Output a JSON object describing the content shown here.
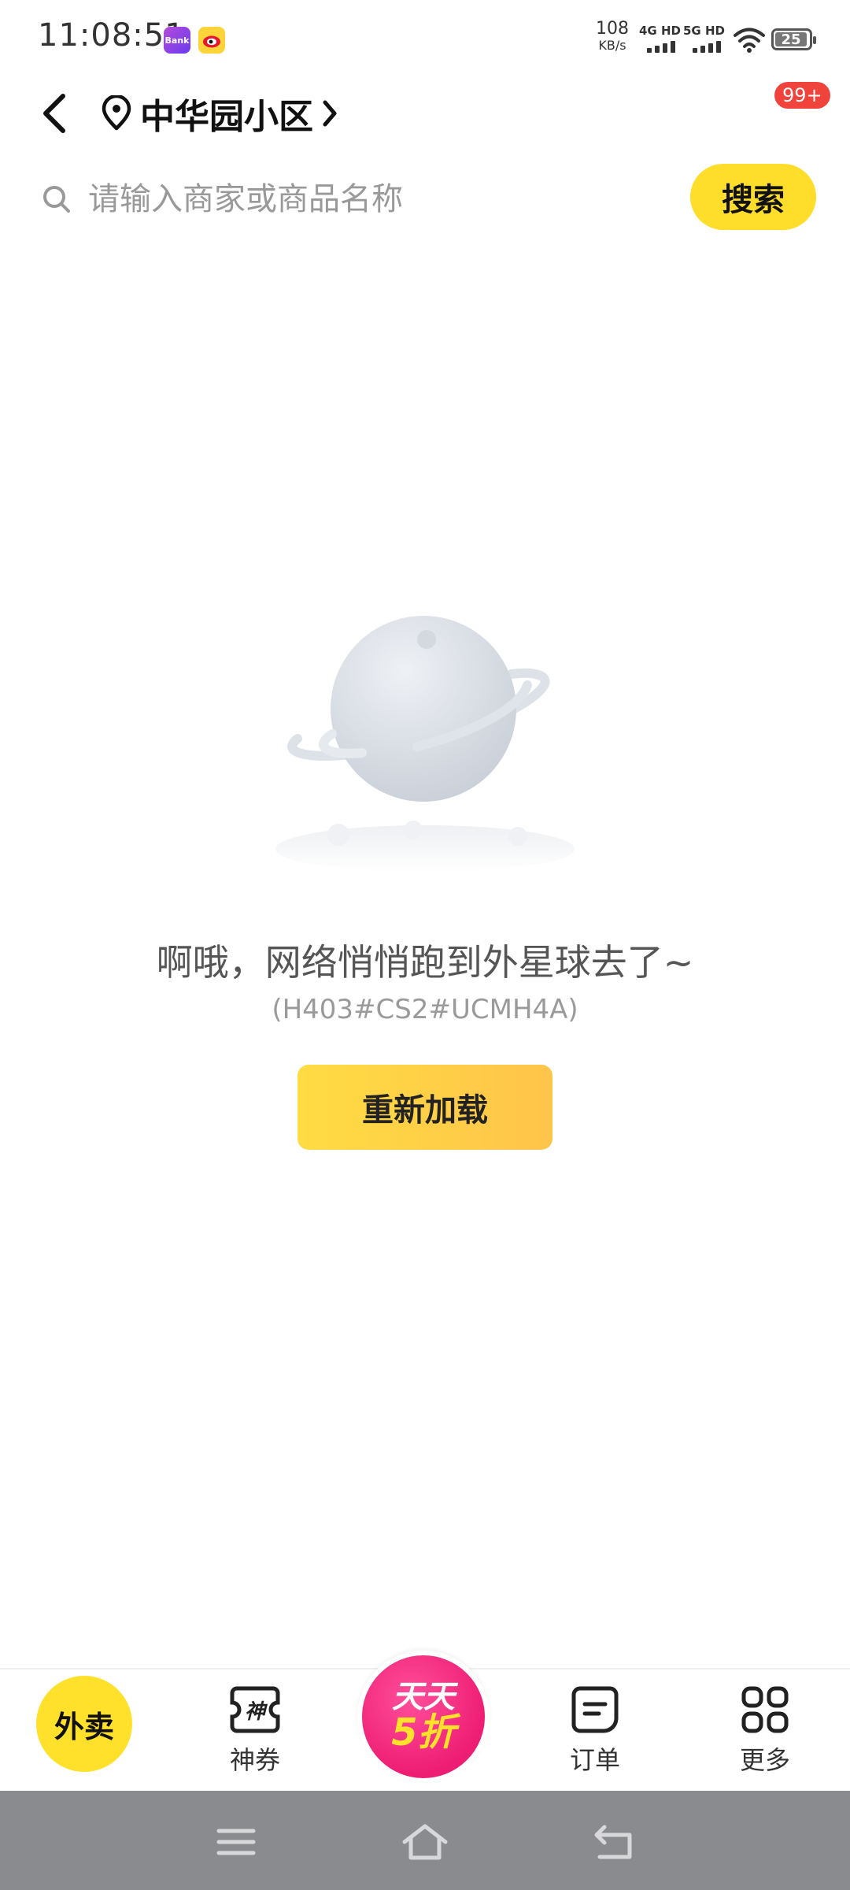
{
  "status_bar": {
    "time": "11:08:51",
    "app_icon_1": "Bank",
    "speed_value": "108",
    "speed_unit": "KB/s",
    "net_1": "4G HD",
    "net_2": "5G HD",
    "battery": "25"
  },
  "header": {
    "location": "中华园小区",
    "message_badge": "99+"
  },
  "search": {
    "placeholder": "请输入商家或商品名称",
    "button_label": "搜索"
  },
  "error": {
    "message": "啊哦，网络悄悄跑到外星球去了~",
    "code": "(H403#CS2#UCMH4A)",
    "reload_label": "重新加载"
  },
  "bottom_nav": {
    "waimai": "外卖",
    "coupon": "神券",
    "promo_line1": "天天",
    "promo_line2": "5折",
    "orders": "订单",
    "more": "更多"
  },
  "colors": {
    "brand_yellow": "#ffdd2b",
    "promo_pink": "#ee1d74",
    "badge_red": "#f0433b"
  }
}
